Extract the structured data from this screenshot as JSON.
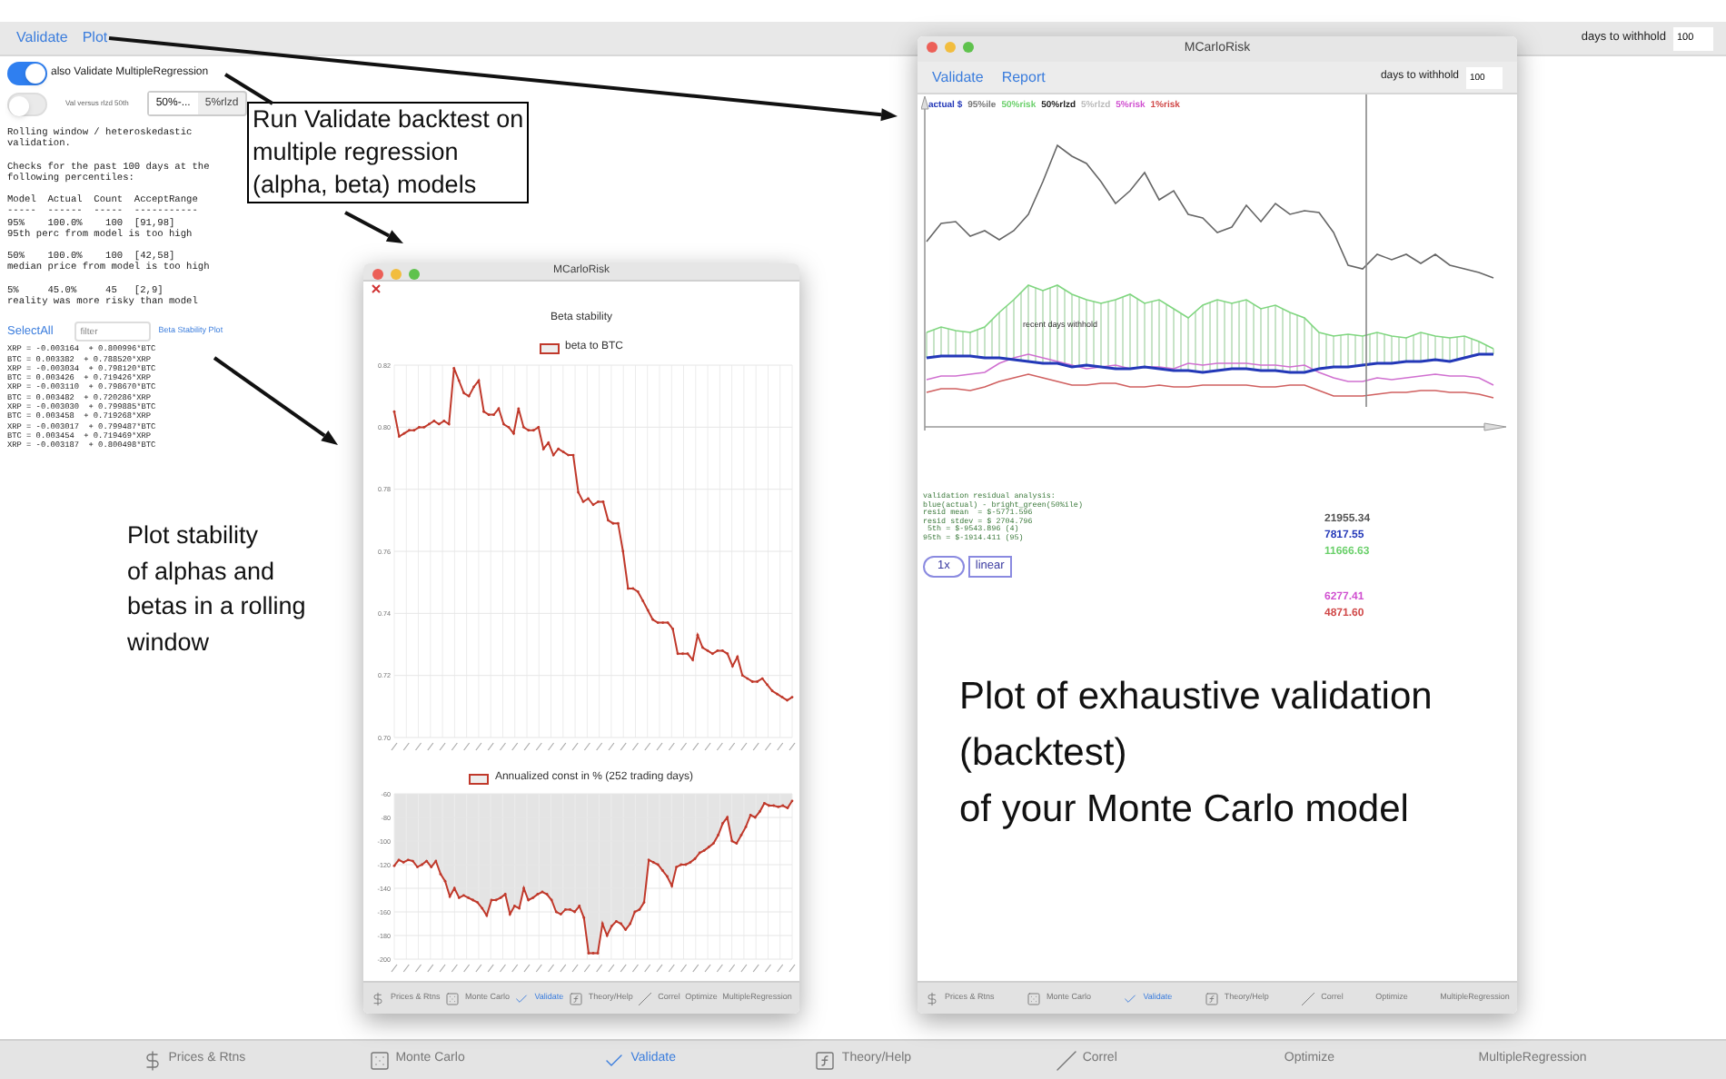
{
  "toolbar": {
    "links": [
      {
        "label": "Validate"
      },
      {
        "label": "Plot"
      }
    ],
    "days_label": "days to withhold",
    "days_value": "100"
  },
  "left_panel": {
    "toggles": [
      {
        "label": "also Validate MultipleRegression",
        "on": true
      },
      {
        "label": "Val versus rlzd 50th",
        "on": false
      }
    ],
    "segments": [
      {
        "label": "50%-...",
        "selected": true
      },
      {
        "label": "5%rlzd",
        "selected": false
      }
    ],
    "report": "Rolling window / heteroskedastic\nvalidation.\n\nChecks for the past 100 days at the\nfollowing percentiles:\n\nModel  Actual  Count  AcceptRange\n-----  ------  -----  -----------\n95%    100.0%    100  [91,98]\n95th perc from model is too high\n\n50%    100.0%    100  [42,58]\nmedian price from model is too high\n\n5%     45.0%     45   [2,9]\nreality was more risky than model",
    "select_all": "SelectAll",
    "filter_placeholder": "filter",
    "plot_link": "Beta Stability Plot",
    "equations": "XRP = -0.003164  + 0.800996*BTC\nBTC = 0.003382  + 0.788520*XRP\nXRP = -0.003034  + 0.798120*BTC\nBTC = 0.003426  + 0.719426*XRP\nXRP = -0.003110  + 0.798670*BTC\nBTC = 0.003482  + 0.720286*XRP\nXRP = -0.003030  + 0.799885*BTC\nBTC = 0.003458  + 0.719268*XRP\nXRP = -0.003017  + 0.799487*BTC\nBTC = 0.003454  + 0.719469*XRP\nXRP = -0.003187  + 0.800498*BTC"
  },
  "beta_window": {
    "title": "MCarloRisk",
    "tabs": [
      {
        "label": "Prices & Rtns",
        "selected": false
      },
      {
        "label": "Monte Carlo",
        "selected": false
      },
      {
        "label": "Validate",
        "selected": true
      },
      {
        "label": "Theory/Help",
        "selected": false
      },
      {
        "label": "Correl",
        "selected": false
      },
      {
        "label": "Optimize",
        "selected": false
      },
      {
        "label": "MultipleRegression",
        "selected": false
      }
    ],
    "charts": [
      {
        "chart_data": {
          "type": "line",
          "title": "Beta stability",
          "grid": true,
          "ylim": [
            0.7,
            0.82
          ],
          "yticks": [
            {
              "value": 0.7,
              "label": "0.70"
            },
            {
              "value": 0.72,
              "label": "0.72"
            },
            {
              "value": 0.74,
              "label": "0.74"
            },
            {
              "value": 0.76,
              "label": "0.76"
            },
            {
              "value": 0.78,
              "label": "0.78"
            },
            {
              "value": 0.8,
              "label": "0.80"
            },
            {
              "value": 0.82,
              "label": "0.82"
            }
          ],
          "series": [
            {
              "name": "beta to BTC",
              "color": "#c0392b",
              "values": [
                0.805,
                0.797,
                0.798,
                0.799,
                0.799,
                0.8,
                0.8,
                0.801,
                0.802,
                0.801,
                0.802,
                0.801,
                0.819,
                0.815,
                0.811,
                0.81,
                0.813,
                0.815,
                0.805,
                0.804,
                0.804,
                0.806,
                0.801,
                0.8,
                0.798,
                0.806,
                0.8,
                0.799,
                0.799,
                0.8,
                0.793,
                0.795,
                0.791,
                0.793,
                0.792,
                0.791,
                0.791,
                0.779,
                0.776,
                0.777,
                0.775,
                0.776,
                0.776,
                0.77,
                0.769,
                0.769,
                0.76,
                0.748,
                0.748,
                0.747,
                0.744,
                0.741,
                0.738,
                0.737,
                0.737,
                0.737,
                0.735,
                0.727,
                0.727,
                0.727,
                0.725,
                0.733,
                0.729,
                0.728,
                0.727,
                0.728,
                0.728,
                0.727,
                0.723,
                0.726,
                0.72,
                0.719,
                0.718,
                0.718,
                0.719,
                0.717,
                0.715,
                0.714,
                0.713,
                0.712,
                0.713
              ]
            }
          ]
        }
      },
      {
        "chart_data": {
          "type": "area",
          "grid": true,
          "ylim": [
            -200,
            -60
          ],
          "yticks": [
            {
              "value": -200,
              "label": "-200"
            },
            {
              "value": -180,
              "label": "-180"
            },
            {
              "value": -160,
              "label": "-160"
            },
            {
              "value": -140,
              "label": "-140"
            },
            {
              "value": -120,
              "label": "-120"
            },
            {
              "value": -100,
              "label": "-100"
            },
            {
              "value": -80,
              "label": "-80"
            },
            {
              "value": -60,
              "label": "-60"
            }
          ],
          "series": [
            {
              "name": "Annualized const in % (252 trading days)",
              "color": "#c0392b",
              "values": [
                -121,
                -116,
                -118,
                -116,
                -117,
                -122,
                -120,
                -117,
                -122,
                -117,
                -128,
                -134,
                -147,
                -140,
                -148,
                -146,
                -148,
                -150,
                -152,
                -157,
                -163,
                -150,
                -150,
                -148,
                -145,
                -162,
                -155,
                -157,
                -140,
                -150,
                -148,
                -145,
                -143,
                -145,
                -150,
                -160,
                -162,
                -158,
                -158,
                -160,
                -155,
                -165,
                -195,
                -195,
                -195,
                -170,
                -180,
                -172,
                -168,
                -170,
                -175,
                -170,
                -160,
                -158,
                -152,
                -116,
                -118,
                -120,
                -125,
                -130,
                -138,
                -122,
                -120,
                -120,
                -118,
                -115,
                -110,
                -108,
                -105,
                -102,
                -95,
                -85,
                -80,
                -100,
                -102,
                -95,
                -88,
                -78,
                -80,
                -75,
                -68,
                -70,
                -70,
                -71,
                -70,
                -72,
                -66
              ]
            }
          ]
        }
      }
    ]
  },
  "risk_window": {
    "title": "MCarloRisk",
    "tabs": [
      {
        "label": "Prices & Rtns",
        "selected": false
      },
      {
        "label": "Monte Carlo",
        "selected": false
      },
      {
        "label": "Validate",
        "selected": true
      },
      {
        "label": "Theory/Help",
        "selected": false
      },
      {
        "label": "Correl",
        "selected": false
      },
      {
        "label": "Optimize",
        "selected": false
      },
      {
        "label": "MultipleRegression",
        "selected": false
      }
    ],
    "links": [
      {
        "label": "Validate"
      },
      {
        "label": "Report"
      }
    ],
    "days_label": "days to withhold",
    "days_value": "100",
    "legend": [
      {
        "label": "actual $",
        "color": "#2338b8"
      },
      {
        "label": "95%ile",
        "color": "#777777"
      },
      {
        "label": "50%risk",
        "color": "#6bd06b"
      },
      {
        "label": "50%rlzd",
        "color": "#222222"
      },
      {
        "label": "5%rlzd",
        "color": "#bbbbbb"
      },
      {
        "label": "5%risk",
        "color": "#d050d0"
      },
      {
        "label": "1%risk",
        "color": "#d04848"
      }
    ],
    "chart_label": "recent days withhold",
    "residual": "validation residual analysis:\nblue(actual) - bright_green(50%ile)\nresid mean  = $-5771.596\nresid stdev = $ 2704.796\n 5th = $-9543.896 (4)\n95th = $-1914.411 (95)",
    "buttons": [
      {
        "label": "1x"
      },
      {
        "label": "linear"
      }
    ],
    "values": [
      {
        "text": "21955.34",
        "color": "#555555"
      },
      {
        "text": "7817.55",
        "color": "#2338b8"
      },
      {
        "text": "11666.63",
        "color": "#6bd06b"
      },
      {
        "text": "6277.41",
        "color": "#d050d0"
      },
      {
        "text": "4871.60",
        "color": "#d04848"
      }
    ]
  },
  "annotations": [
    {
      "text": "Run Validate backtest on\nmultiple regression\n(alpha, beta) models",
      "boxed": true
    },
    {
      "text": "Plot stability\nof alphas and\nbetas in a rolling\nwindow",
      "boxed": false
    },
    {
      "text": "Plot of exhaustive validation\n(backtest)\nof your Monte Carlo model",
      "boxed": false
    }
  ],
  "tabs": [
    {
      "label": "Prices & Rtns",
      "selected": false
    },
    {
      "label": "Monte Carlo",
      "selected": false
    },
    {
      "label": "Validate",
      "selected": true
    },
    {
      "label": "Theory/Help",
      "selected": false
    },
    {
      "label": "Correl",
      "selected": false
    },
    {
      "label": "Optimize",
      "selected": false
    },
    {
      "label": "MultipleRegression",
      "selected": false
    }
  ]
}
